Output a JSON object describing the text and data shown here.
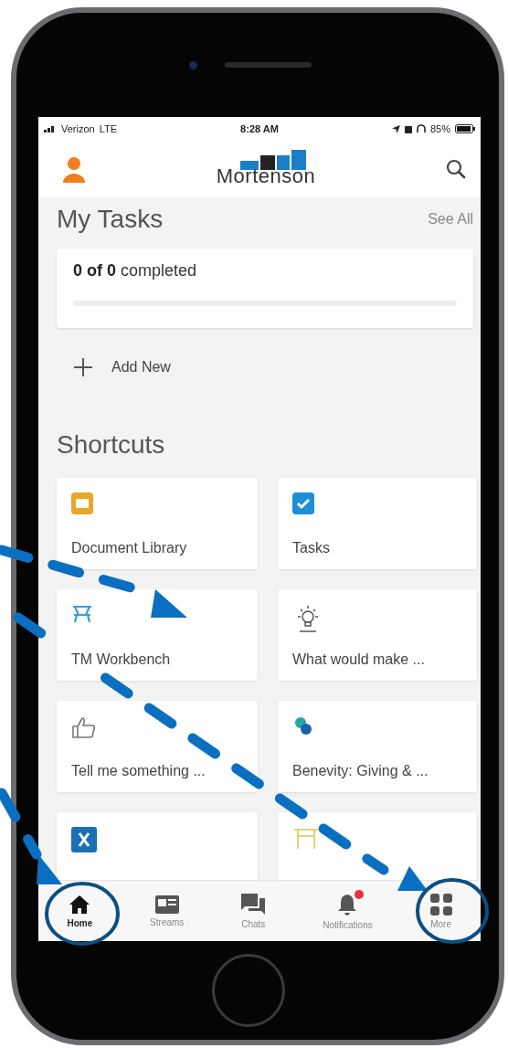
{
  "status_bar": {
    "carrier": "Verizon",
    "network": "LTE",
    "time": "8:28 AM",
    "battery": "85%"
  },
  "header": {
    "logo_text": "Mortenson"
  },
  "my_tasks": {
    "title": "My Tasks",
    "see_all": "See All",
    "summary": "**0 of 0** completed",
    "level": 0,
    "add_new": "Add New"
  },
  "shortcuts": {
    "title": "Shortcuts",
    "items": [
      {
        "kind": "folder",
        "label": "Document Library"
      },
      {
        "kind": "check",
        "label": "Tasks"
      },
      {
        "kind": "workbench",
        "label": "TM Workbench"
      },
      {
        "kind": "bulb",
        "label": "What would make ..."
      },
      {
        "kind": "thumb",
        "label": "Tell me something ..."
      },
      {
        "kind": "giving",
        "label": "Benevity: Giving & ..."
      },
      {
        "kind": "excel"
      },
      {
        "kind": "frame"
      }
    ]
  },
  "tab_bar": [
    {
      "kind": "home",
      "label": "Home",
      "selected": true,
      "badge": false
    },
    {
      "kind": "streams",
      "label": "Streams",
      "selected": false,
      "badge": false
    },
    {
      "kind": "chats",
      "label": "Chats",
      "selected": false,
      "badge": false
    },
    {
      "kind": "bell",
      "label": "Notifications",
      "selected": false,
      "badge": true
    },
    {
      "kind": "grid",
      "label": "More",
      "selected": false,
      "badge": false
    }
  ]
}
